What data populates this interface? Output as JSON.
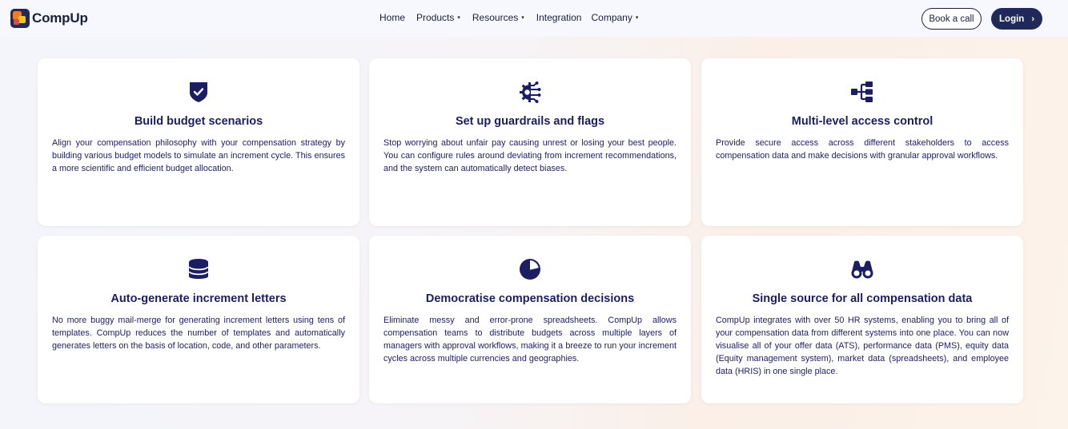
{
  "brand": {
    "name": "CompUp"
  },
  "nav": {
    "items": [
      {
        "label": "Home",
        "has_dropdown": false
      },
      {
        "label": "Products",
        "has_dropdown": true
      },
      {
        "label": "Resources",
        "has_dropdown": true
      },
      {
        "label": "Integration",
        "has_dropdown": false
      },
      {
        "label": "Company",
        "has_dropdown": true
      }
    ],
    "dropdown_caret": "▾",
    "book_call_label": "Book a call",
    "login_label": "Login",
    "login_chevron": "›"
  },
  "colors": {
    "primary_navy": "#1c1e63",
    "button_navy": "#20295a",
    "logo_orange": "#f07b2c",
    "logo_yellow": "#f9c124",
    "logo_red": "#e8483a",
    "logo_navy": "#20295a"
  },
  "features": [
    {
      "icon": "shield-check-icon",
      "title": "Build budget scenarios",
      "description": "Align your compensation philosophy with your compensation strategy by building various budget models to simulate an increment cycle. This ensures a more scientific and efficient budget allocation."
    },
    {
      "icon": "gear-circuit-icon",
      "title": "Set up guardrails and flags",
      "description": "Stop worrying about unfair pay causing unrest or losing your best people. You can configure rules around deviating from increment recommendations, and the system can automatically detect biases."
    },
    {
      "icon": "hierarchy-icon",
      "title": "Multi-level access control",
      "description": "Provide secure access across different stakeholders to access compensation data and make decisions with granular approval workflows."
    },
    {
      "icon": "database-icon",
      "title": "Auto-generate increment letters",
      "description": "No more buggy mail-merge for generating increment letters using tens of templates. CompUp reduces the number of templates and automatically generates letters on the basis of location, code, and other parameters."
    },
    {
      "icon": "pie-chart-icon",
      "title": "Democratise compensation decisions",
      "description": "Eliminate messy and error-prone spreadsheets. CompUp allows compensation teams to distribute budgets across multiple layers of managers with approval workflows, making it a breeze to run your increment cycles across multiple currencies and geographies."
    },
    {
      "icon": "binoculars-icon",
      "title": "Single source for all compensation data",
      "description": "CompUp integrates with over 50 HR systems, enabling you to bring all of your compensation data from different systems into one place. You can now visualise all of your offer data (ATS), performance data (PMS), equity data (Equity management system), market data (spreadsheets), and employee data (HRIS) in one single place."
    }
  ]
}
